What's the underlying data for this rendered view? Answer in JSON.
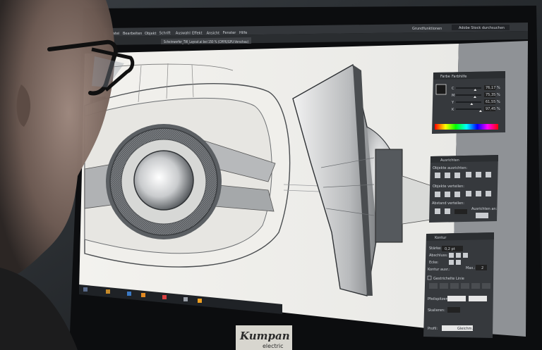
{
  "app": {
    "workspace_label": "Grundfunktionen",
    "search_placeholder": "Adobe Stock durchsuchen",
    "document_tab": "Scheinwerfer_TW_Layout.ai bei 150 % (CMYK/GPU-Vorschau)"
  },
  "menu": {
    "items": [
      "Datei",
      "Bearbeiten",
      "Objekt",
      "Schrift",
      "Auswahl",
      "Effekt",
      "Ansicht",
      "Fenster",
      "Hilfe"
    ]
  },
  "color_panel": {
    "tabs": [
      "Farbe",
      "Farbhilfe"
    ],
    "channels": [
      {
        "label": "C",
        "value": "76,17",
        "unit": "%",
        "level": 0.76
      },
      {
        "label": "M",
        "value": "75,35",
        "unit": "%",
        "level": 0.75
      },
      {
        "label": "Y",
        "value": "61,55",
        "unit": "%",
        "level": 0.62
      },
      {
        "label": "K",
        "value": "97,45",
        "unit": "%",
        "level": 0.97
      }
    ]
  },
  "align_panel": {
    "title": "Ausrichten",
    "section_objects": "Objekte ausrichten:",
    "section_distribute": "Objekte verteilen:",
    "section_spacing": "Abstand verteilen:",
    "align_to": "Ausrichten an:"
  },
  "stroke_panel": {
    "title": "Kontur",
    "weight_label": "Stärke:",
    "weight_value": "0,2 pt",
    "cap_label": "Abschluss:",
    "corner_label": "Ecke:",
    "align_label": "Kontur ausr.:",
    "limit_label": "Max.:",
    "limit_value": "2",
    "dashed_label": "Gestrichelte Linie",
    "arrow_label": "Pfeilspitzen:",
    "scale_label": "Skalieren:",
    "profile_label": "Profil:",
    "profile_value": "Gleichm."
  },
  "monitor": {
    "brand": "Kumpan",
    "brand_sub": "electric"
  }
}
